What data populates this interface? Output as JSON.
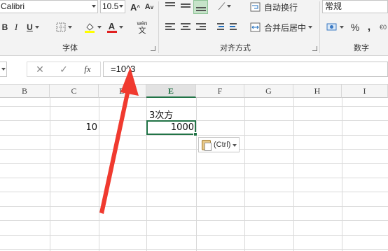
{
  "ribbon": {
    "font_name": "Calibri",
    "font_size": "10.5",
    "grow_font": "A",
    "shrink_font": "A",
    "bold": "B",
    "italic": "I",
    "underline": "U",
    "font_color_glyph": "A",
    "phonetic_top": "wén",
    "phonetic_bottom": "文",
    "group_font": "字体",
    "group_alignment": "对齐方式",
    "group_number": "数字",
    "wrap_text": "自动换行",
    "merge_center": "合并后居中",
    "number_format": "常规",
    "percent": "%",
    "comma": ","
  },
  "formula_bar": {
    "cancel": "✕",
    "enter": "✓",
    "fx": "fx",
    "formula": "=10^3"
  },
  "columns": [
    "B",
    "C",
    "D",
    "E",
    "F",
    "G",
    "H",
    "I"
  ],
  "active_column": "E",
  "cells": {
    "E8": "3次方",
    "C9": "10",
    "E9": "1000"
  },
  "paste_options": "(Ctrl)",
  "colors": {
    "accent": "#217346",
    "arrow": "#f03a2f"
  }
}
